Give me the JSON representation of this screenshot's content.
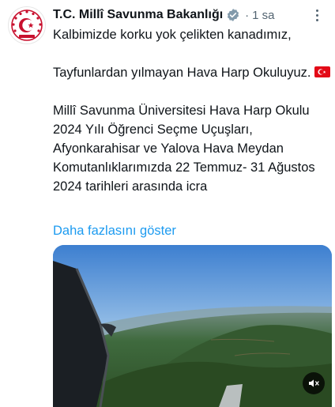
{
  "tweet": {
    "author": {
      "name": "T.C. Millî Savunma Bakanlığı"
    },
    "separator": "·",
    "timestamp": "1 sa",
    "text": {
      "line1": "Kalbimizde korku yok çelikten kanadımız,",
      "line2": "Tayfunlardan yılmayan Hava Harp Okuluyuz.",
      "line3": "Millî Savunma Üniversitesi Hava Harp Okulu 2024 Yılı Öğrenci Seçme Uçuşları, Afyonkarahisar ve Yalova Hava Meydan Komutanlıklarımızda 22 Temmuz- 31 Ağustos 2024 tarihleri arasında icra"
    },
    "show_more": "Daha fazlasını göster",
    "icons": {
      "verified": "verified-gray-badge-icon",
      "more": "more-vertical-icon",
      "flag": "turkey-flag-emoji",
      "mute": "speaker-muted-icon"
    },
    "colors": {
      "link": "#1d9bf0",
      "secondary_text": "#536471",
      "badge": "#829aab",
      "crest": "#c8102e"
    }
  }
}
